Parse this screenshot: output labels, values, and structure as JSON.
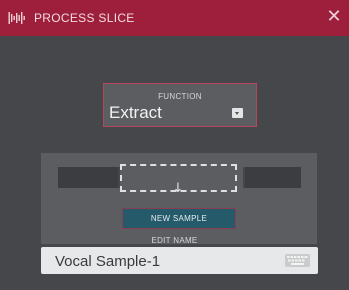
{
  "window": {
    "title": "PROCESS SLICE",
    "icons": {
      "app": "waveform-icon",
      "close": "close-icon",
      "dropdown": "dropdown-icon",
      "arrow": "down-arrow-icon",
      "keyboard": "keyboard-icon"
    }
  },
  "function": {
    "label": "FUNCTION",
    "value": "Extract"
  },
  "slice": {
    "new_sample_label": "NEW SAMPLE"
  },
  "edit_name": {
    "label": "EDIT NAME",
    "value": "Vocal Sample-1"
  },
  "colors": {
    "accent": "#9e1f3c",
    "panel": "#46474a",
    "button": "#245a6a"
  }
}
